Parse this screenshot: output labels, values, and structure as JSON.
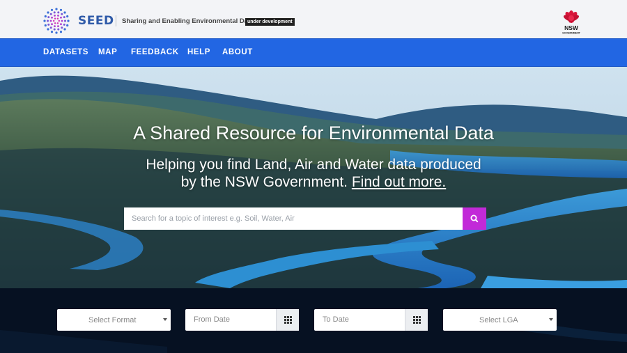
{
  "header": {
    "brand": "SEED",
    "tagline": "Sharing and Enabling Environmental Data",
    "badge": "under development",
    "gov_logo_text": "NSW",
    "gov_logo_subtext": "GOVERNMENT"
  },
  "nav": {
    "items": [
      "DATASETS",
      "MAP",
      "FEEDBACK",
      "HELP",
      "ABOUT"
    ]
  },
  "hero": {
    "title": "A Shared Resource for Environmental Data",
    "subtitle_line1": "Helping you find Land, Air and Water data produced",
    "subtitle_line2": "by the NSW Government.",
    "subtitle_link": "Find out more."
  },
  "search": {
    "placeholder": "Search for a topic of interest e.g. Soil, Water, Air",
    "value": "",
    "button_icon": "search-icon"
  },
  "filters": {
    "format": "Select Format",
    "from_date": "From Date",
    "to_date": "To Date",
    "lga": "Select LGA",
    "calendar_icon": "calendar-grid-icon",
    "dropdown_icon": "caret-down-icon"
  },
  "colors": {
    "nav_bg": "#2266e3",
    "brand": "#2f5aa8",
    "search_button": "#c22ad8",
    "nsw_red": "#d7153a"
  }
}
